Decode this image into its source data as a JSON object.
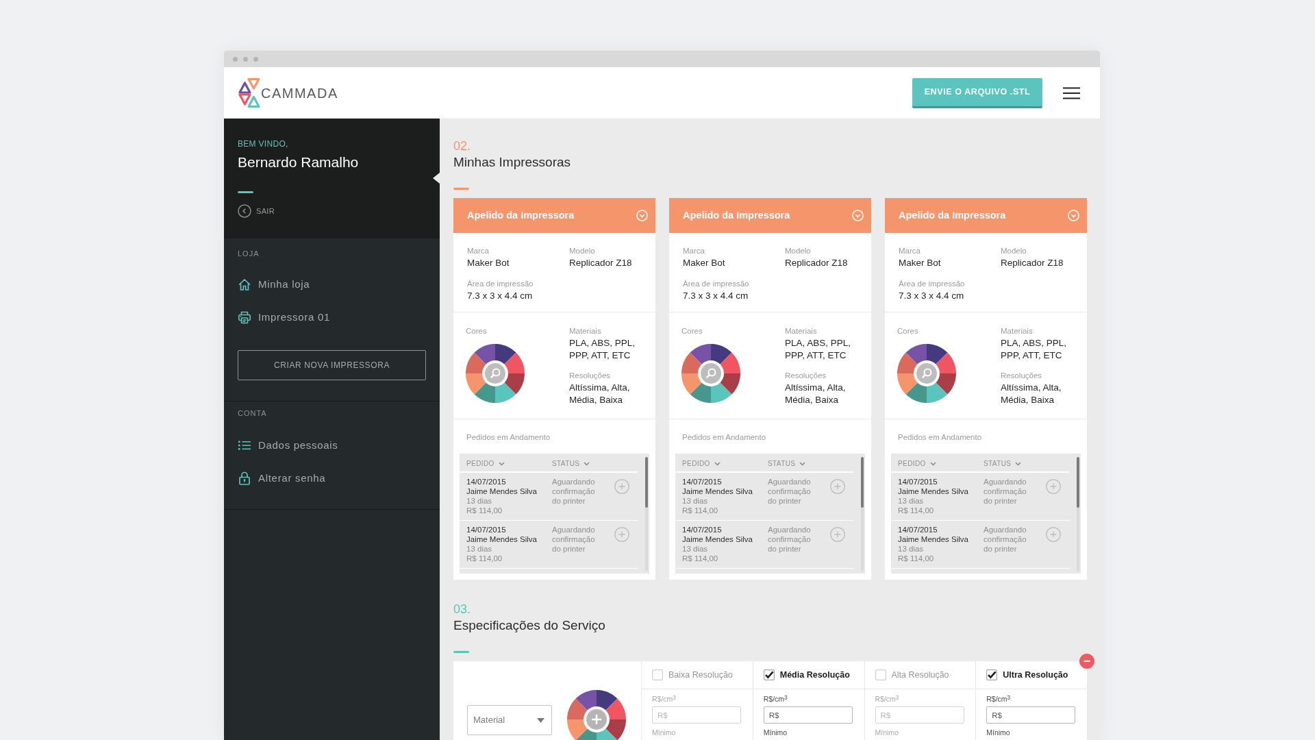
{
  "header": {
    "logo": "CAMMADA",
    "upload_button": "ENVIE O ARQUIVO .STL"
  },
  "sidebar": {
    "greeting": "BEM VINDO,",
    "user_name": "Bernardo Ramalho",
    "logout": "SAIR",
    "groups": [
      {
        "title": "LOJA",
        "items": [
          {
            "label": "Minha loja"
          },
          {
            "label": "Impressora 01"
          }
        ],
        "button": "CRIAR NOVA IMPRESSORA"
      },
      {
        "title": "CONTA",
        "items": [
          {
            "label": "Dados pessoais"
          },
          {
            "label": "Alterar senha"
          }
        ]
      }
    ]
  },
  "printers_section": {
    "number": "02.",
    "title": "Minhas Impressoras",
    "color": "#f4956b",
    "printers": [
      {
        "name": "Apelido da Impressora",
        "fields": [
          {
            "label": "Marca",
            "value": "Maker Bot"
          },
          {
            "label": "Modelo",
            "value": "Replicador Z18"
          },
          {
            "label": "Área de impressão",
            "value": "7.3 x 3 x 4.4 cm"
          }
        ],
        "colors_label": "Cores",
        "colors": [
          {
            "color": "#453a7f"
          },
          {
            "color": "#ef5662"
          },
          {
            "color": "#a93d48"
          },
          {
            "color": "#5ac5bd"
          },
          {
            "color": "#46978c"
          },
          {
            "color": "#f4956b"
          },
          {
            "color": "#d96a5c"
          },
          {
            "color": "#7653a6"
          }
        ],
        "specs": [
          {
            "label": "Materiais",
            "value": "PLA, ABS, PPL, PPP, ATT, ETC"
          },
          {
            "label": "Resoluções",
            "value": "Altíssima, Alta, Média, Baixa"
          }
        ],
        "orders": {
          "title": "Pedidos em Andamento",
          "columns": [
            "PEDIDO",
            "STATUS"
          ],
          "rows": [
            {
              "date": "14/07/2015",
              "customer": "Jaime Mendes Silva",
              "duration": "13 dias",
              "price": "R$ 114,00",
              "status": "Aguardando confirmação do printer"
            },
            {
              "date": "14/07/2015",
              "customer": "Jaime Mendes Silva",
              "duration": "13 dias",
              "price": "R$ 114,00",
              "status": "Aguardando confirmação do printer"
            }
          ]
        }
      },
      {
        "name": "Apelido da Impressora",
        "fields": [
          {
            "label": "Marca",
            "value": "Maker Bot"
          },
          {
            "label": "Modelo",
            "value": "Replicador Z18"
          },
          {
            "label": "Área de impressão",
            "value": "7.3 x 3 x 4.4 cm"
          }
        ],
        "colors_label": "Cores",
        "colors": [
          {
            "color": "#453a7f"
          },
          {
            "color": "#ef5662"
          },
          {
            "color": "#a93d48"
          },
          {
            "color": "#5ac5bd"
          },
          {
            "color": "#46978c"
          },
          {
            "color": "#f4956b"
          },
          {
            "color": "#d96a5c"
          },
          {
            "color": "#7653a6"
          }
        ],
        "specs": [
          {
            "label": "Materiais",
            "value": "PLA, ABS, PPL, PPP, ATT, ETC"
          },
          {
            "label": "Resoluções",
            "value": "Altíssima, Alta, Média, Baixa"
          }
        ],
        "orders": {
          "title": "Pedidos em Andamento",
          "columns": [
            "PEDIDO",
            "STATUS"
          ],
          "rows": [
            {
              "date": "14/07/2015",
              "customer": "Jaime Mendes Silva",
              "duration": "13 dias",
              "price": "R$ 114,00",
              "status": "Aguardando confirmação do printer"
            },
            {
              "date": "14/07/2015",
              "customer": "Jaime Mendes Silva",
              "duration": "13 dias",
              "price": "R$ 114,00",
              "status": "Aguardando confirmação do printer"
            }
          ]
        }
      },
      {
        "name": "Apelido da Impressora",
        "fields": [
          {
            "label": "Marca",
            "value": "Maker Bot"
          },
          {
            "label": "Modelo",
            "value": "Replicador Z18"
          },
          {
            "label": "Área de impressão",
            "value": "7.3 x 3 x 4.4 cm"
          }
        ],
        "colors_label": "Cores",
        "colors": [
          {
            "color": "#453a7f"
          },
          {
            "color": "#ef5662"
          },
          {
            "color": "#a93d48"
          },
          {
            "color": "#5ac5bd"
          },
          {
            "color": "#46978c"
          },
          {
            "color": "#f4956b"
          },
          {
            "color": "#d96a5c"
          },
          {
            "color": "#7653a6"
          }
        ],
        "specs": [
          {
            "label": "Materiais",
            "value": "PLA, ABS, PPL, PPP, ATT, ETC"
          },
          {
            "label": "Resoluções",
            "value": "Altíssima, Alta, Média, Baixa"
          }
        ],
        "orders": {
          "title": "Pedidos em Andamento",
          "columns": [
            "PEDIDO",
            "STATUS"
          ],
          "rows": [
            {
              "date": "14/07/2015",
              "customer": "Jaime Mendes Silva",
              "duration": "13 dias",
              "price": "R$ 114,00",
              "status": "Aguardando confirmação do printer"
            },
            {
              "date": "14/07/2015",
              "customer": "Jaime Mendes Silva",
              "duration": "13 dias",
              "price": "R$ 114,00",
              "status": "Aguardando confirmação do printer"
            }
          ]
        }
      }
    ]
  },
  "service_section": {
    "number": "03.",
    "title": "Especificações do Serviço",
    "color": "#5ac5bd",
    "material_select": {
      "placeholder": "Material"
    },
    "colors": [
      {
        "color": "#453a7f"
      },
      {
        "color": "#ef5662"
      },
      {
        "color": "#a93d48"
      },
      {
        "color": "#5ac5bd"
      },
      {
        "color": "#46978c"
      },
      {
        "color": "#f4956b"
      },
      {
        "color": "#d96a5c"
      },
      {
        "color": "#7653a6"
      }
    ],
    "resolutions": [
      {
        "label": "Baixa Resolução",
        "checked": false,
        "price_label": "R$/cm$^{3}$",
        "price_field": {
          "placeholder": "R$"
        },
        "minimum_label": "Mínimo"
      },
      {
        "label": "Média Resolução",
        "checked": true,
        "price_label": "R$/cm$^{3}$",
        "price_field": {
          "placeholder": "R$"
        },
        "minimum_label": "Mínimo"
      },
      {
        "label": "Alta Resolução",
        "checked": false,
        "price_label": "R$/cm$^{3}$",
        "price_field": {
          "placeholder": "R$"
        },
        "minimum_label": "Mínimo"
      },
      {
        "label": "Ultra Resolução",
        "checked": true,
        "price_label": "R$/cm$^{3}$",
        "price_field": {
          "placeholder": "R$"
        },
        "minimum_label": "Mínimo"
      }
    ]
  }
}
